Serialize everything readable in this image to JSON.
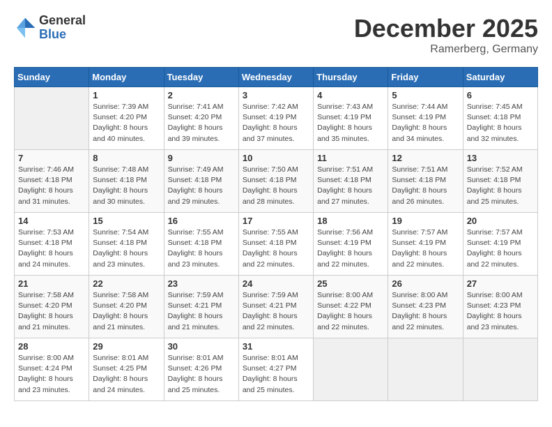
{
  "logo": {
    "general": "General",
    "blue": "Blue"
  },
  "title": "December 2025",
  "location": "Ramerberg, Germany",
  "days_of_week": [
    "Sunday",
    "Monday",
    "Tuesday",
    "Wednesday",
    "Thursday",
    "Friday",
    "Saturday"
  ],
  "weeks": [
    [
      {
        "day": "",
        "sunrise": "",
        "sunset": "",
        "daylight": ""
      },
      {
        "day": "1",
        "sunrise": "Sunrise: 7:39 AM",
        "sunset": "Sunset: 4:20 PM",
        "daylight": "Daylight: 8 hours and 40 minutes."
      },
      {
        "day": "2",
        "sunrise": "Sunrise: 7:41 AM",
        "sunset": "Sunset: 4:20 PM",
        "daylight": "Daylight: 8 hours and 39 minutes."
      },
      {
        "day": "3",
        "sunrise": "Sunrise: 7:42 AM",
        "sunset": "Sunset: 4:19 PM",
        "daylight": "Daylight: 8 hours and 37 minutes."
      },
      {
        "day": "4",
        "sunrise": "Sunrise: 7:43 AM",
        "sunset": "Sunset: 4:19 PM",
        "daylight": "Daylight: 8 hours and 35 minutes."
      },
      {
        "day": "5",
        "sunrise": "Sunrise: 7:44 AM",
        "sunset": "Sunset: 4:19 PM",
        "daylight": "Daylight: 8 hours and 34 minutes."
      },
      {
        "day": "6",
        "sunrise": "Sunrise: 7:45 AM",
        "sunset": "Sunset: 4:18 PM",
        "daylight": "Daylight: 8 hours and 32 minutes."
      }
    ],
    [
      {
        "day": "7",
        "sunrise": "Sunrise: 7:46 AM",
        "sunset": "Sunset: 4:18 PM",
        "daylight": "Daylight: 8 hours and 31 minutes."
      },
      {
        "day": "8",
        "sunrise": "Sunrise: 7:48 AM",
        "sunset": "Sunset: 4:18 PM",
        "daylight": "Daylight: 8 hours and 30 minutes."
      },
      {
        "day": "9",
        "sunrise": "Sunrise: 7:49 AM",
        "sunset": "Sunset: 4:18 PM",
        "daylight": "Daylight: 8 hours and 29 minutes."
      },
      {
        "day": "10",
        "sunrise": "Sunrise: 7:50 AM",
        "sunset": "Sunset: 4:18 PM",
        "daylight": "Daylight: 8 hours and 28 minutes."
      },
      {
        "day": "11",
        "sunrise": "Sunrise: 7:51 AM",
        "sunset": "Sunset: 4:18 PM",
        "daylight": "Daylight: 8 hours and 27 minutes."
      },
      {
        "day": "12",
        "sunrise": "Sunrise: 7:51 AM",
        "sunset": "Sunset: 4:18 PM",
        "daylight": "Daylight: 8 hours and 26 minutes."
      },
      {
        "day": "13",
        "sunrise": "Sunrise: 7:52 AM",
        "sunset": "Sunset: 4:18 PM",
        "daylight": "Daylight: 8 hours and 25 minutes."
      }
    ],
    [
      {
        "day": "14",
        "sunrise": "Sunrise: 7:53 AM",
        "sunset": "Sunset: 4:18 PM",
        "daylight": "Daylight: 8 hours and 24 minutes."
      },
      {
        "day": "15",
        "sunrise": "Sunrise: 7:54 AM",
        "sunset": "Sunset: 4:18 PM",
        "daylight": "Daylight: 8 hours and 23 minutes."
      },
      {
        "day": "16",
        "sunrise": "Sunrise: 7:55 AM",
        "sunset": "Sunset: 4:18 PM",
        "daylight": "Daylight: 8 hours and 23 minutes."
      },
      {
        "day": "17",
        "sunrise": "Sunrise: 7:55 AM",
        "sunset": "Sunset: 4:18 PM",
        "daylight": "Daylight: 8 hours and 22 minutes."
      },
      {
        "day": "18",
        "sunrise": "Sunrise: 7:56 AM",
        "sunset": "Sunset: 4:19 PM",
        "daylight": "Daylight: 8 hours and 22 minutes."
      },
      {
        "day": "19",
        "sunrise": "Sunrise: 7:57 AM",
        "sunset": "Sunset: 4:19 PM",
        "daylight": "Daylight: 8 hours and 22 minutes."
      },
      {
        "day": "20",
        "sunrise": "Sunrise: 7:57 AM",
        "sunset": "Sunset: 4:19 PM",
        "daylight": "Daylight: 8 hours and 22 minutes."
      }
    ],
    [
      {
        "day": "21",
        "sunrise": "Sunrise: 7:58 AM",
        "sunset": "Sunset: 4:20 PM",
        "daylight": "Daylight: 8 hours and 21 minutes."
      },
      {
        "day": "22",
        "sunrise": "Sunrise: 7:58 AM",
        "sunset": "Sunset: 4:20 PM",
        "daylight": "Daylight: 8 hours and 21 minutes."
      },
      {
        "day": "23",
        "sunrise": "Sunrise: 7:59 AM",
        "sunset": "Sunset: 4:21 PM",
        "daylight": "Daylight: 8 hours and 21 minutes."
      },
      {
        "day": "24",
        "sunrise": "Sunrise: 7:59 AM",
        "sunset": "Sunset: 4:21 PM",
        "daylight": "Daylight: 8 hours and 22 minutes."
      },
      {
        "day": "25",
        "sunrise": "Sunrise: 8:00 AM",
        "sunset": "Sunset: 4:22 PM",
        "daylight": "Daylight: 8 hours and 22 minutes."
      },
      {
        "day": "26",
        "sunrise": "Sunrise: 8:00 AM",
        "sunset": "Sunset: 4:23 PM",
        "daylight": "Daylight: 8 hours and 22 minutes."
      },
      {
        "day": "27",
        "sunrise": "Sunrise: 8:00 AM",
        "sunset": "Sunset: 4:23 PM",
        "daylight": "Daylight: 8 hours and 23 minutes."
      }
    ],
    [
      {
        "day": "28",
        "sunrise": "Sunrise: 8:00 AM",
        "sunset": "Sunset: 4:24 PM",
        "daylight": "Daylight: 8 hours and 23 minutes."
      },
      {
        "day": "29",
        "sunrise": "Sunrise: 8:01 AM",
        "sunset": "Sunset: 4:25 PM",
        "daylight": "Daylight: 8 hours and 24 minutes."
      },
      {
        "day": "30",
        "sunrise": "Sunrise: 8:01 AM",
        "sunset": "Sunset: 4:26 PM",
        "daylight": "Daylight: 8 hours and 25 minutes."
      },
      {
        "day": "31",
        "sunrise": "Sunrise: 8:01 AM",
        "sunset": "Sunset: 4:27 PM",
        "daylight": "Daylight: 8 hours and 25 minutes."
      },
      {
        "day": "",
        "sunrise": "",
        "sunset": "",
        "daylight": ""
      },
      {
        "day": "",
        "sunrise": "",
        "sunset": "",
        "daylight": ""
      },
      {
        "day": "",
        "sunrise": "",
        "sunset": "",
        "daylight": ""
      }
    ]
  ]
}
